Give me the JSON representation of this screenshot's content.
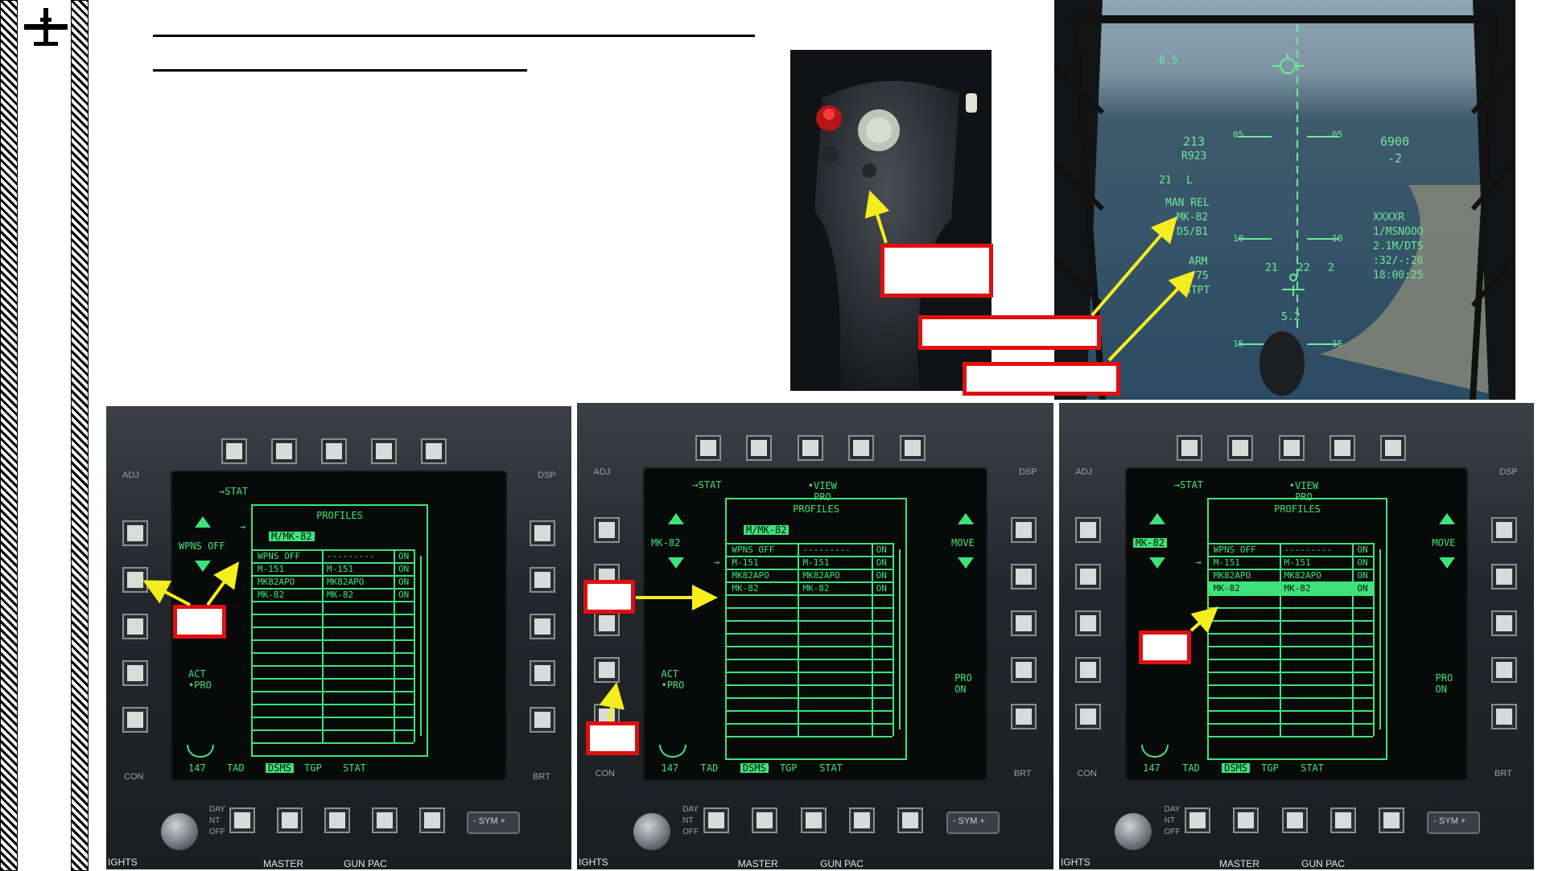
{
  "slide": {
    "logo_icon": "aircraft-silhouette-icon"
  },
  "hud": {
    "pitch_top": "0.5",
    "airspeed": "213",
    "range": "R923",
    "left_21": "21",
    "left_L": "L",
    "weapon_mode": "MAN REL",
    "weapon": "MK-82",
    "profile": "D5/B1",
    "arm": "ARM",
    "arm_75": "75",
    "steerpoint": "STPT",
    "altitude": "6900",
    "vvi": "-2",
    "right_1": "XXXXR",
    "right_2": "1/MSNOOO",
    "right_3": "2.1M/DTS",
    "right_4": ":32/-:26",
    "right_5": "18:00:25",
    "ladder_05l": "05",
    "ladder_05r": "05",
    "ladder_10l": "10",
    "ladder_10r": "10",
    "ladder_15l": "15",
    "ladder_15r": "15",
    "center_21": "21",
    "center_22": "22",
    "center_2": "2",
    "center_52": "5.2"
  },
  "panels": [
    {
      "left_top": "WPNS OFF",
      "left_top_highlight": false,
      "stat": "→STAT",
      "view_pro": "",
      "move": "",
      "title": "PROFILES",
      "selected": "M/MK-82",
      "rows": [
        [
          "WPNS OFF",
          "---------",
          "ON"
        ],
        [
          "M-151",
          "M-151",
          "ON"
        ],
        [
          "MK82APO",
          "MK82APO",
          "ON"
        ],
        [
          "MK-82",
          "MK-82",
          "ON"
        ]
      ],
      "highlight_row": -1,
      "act_pro": "ACT\n•PRO",
      "pro_on": "",
      "bottom_147": "147",
      "tabs": [
        "TAD",
        "DSMS",
        "TGP",
        "STAT"
      ],
      "adj": "ADJ",
      "dsp": "DSP",
      "con": "CON",
      "brt": "BRT",
      "day": "DAY",
      "nt": "NT",
      "off": "OFF",
      "sym": "- SYM +",
      "under_left": "IGHTS",
      "under_mid": "MASTER",
      "under_right": "GUN PAC"
    },
    {
      "left_top": "MK-82",
      "left_top_highlight": false,
      "stat": "→STAT",
      "view_pro": "•VIEW\nPRO",
      "move": "MOVE",
      "title": "PROFILES",
      "selected": "M/MK-82",
      "rows": [
        [
          "WPNS OFF",
          "---------",
          "ON"
        ],
        [
          "M-151",
          "M-151",
          "ON"
        ],
        [
          "MK82APO",
          "MK82APO",
          "ON"
        ],
        [
          "MK-82",
          "MK-82",
          "ON"
        ]
      ],
      "highlight_row": -1,
      "act_pro": "ACT\n•PRO",
      "pro_on": "PRO\nON",
      "bottom_147": "147",
      "tabs": [
        "TAD",
        "DSMS",
        "TGP",
        "STAT"
      ],
      "adj": "ADJ",
      "dsp": "DSP",
      "con": "CON",
      "brt": "BRT",
      "day": "DAY",
      "nt": "NT",
      "off": "OFF",
      "sym": "- SYM +",
      "under_left": "IGHTS",
      "under_mid": "MASTER",
      "under_right": "GUN PAC"
    },
    {
      "left_top": "MK-82",
      "left_top_highlight": true,
      "stat": "→STAT",
      "view_pro": "•VIEW\nPRO",
      "move": "MOVE",
      "title": "PROFILES",
      "selected": "",
      "rows": [
        [
          "WPNS OFF",
          "---------",
          "ON"
        ],
        [
          "M-151",
          "M-151",
          "ON"
        ],
        [
          "MK82APO",
          "MK82APO",
          "ON"
        ],
        [
          "MK-82",
          "MK-82",
          "ON"
        ]
      ],
      "highlight_row": 3,
      "act_pro": "",
      "pro_on": "PRO\nON",
      "bottom_147": "147",
      "tabs": [
        "TAD",
        "DSMS",
        "TGP",
        "STAT"
      ],
      "adj": "ADJ",
      "dsp": "DSP",
      "con": "CON",
      "brt": "BRT",
      "day": "DAY",
      "nt": "NT",
      "off": "OFF",
      "sym": "- SYM +",
      "under_left": "IGHTS",
      "under_mid": "MASTER",
      "under_right": "GUN PAC"
    }
  ],
  "colors": {
    "mfcd_green": "#3ee27a",
    "callout_red": "#e01010",
    "arrow_yellow": "#f5ee1e",
    "hud_green": "#6de89a"
  }
}
